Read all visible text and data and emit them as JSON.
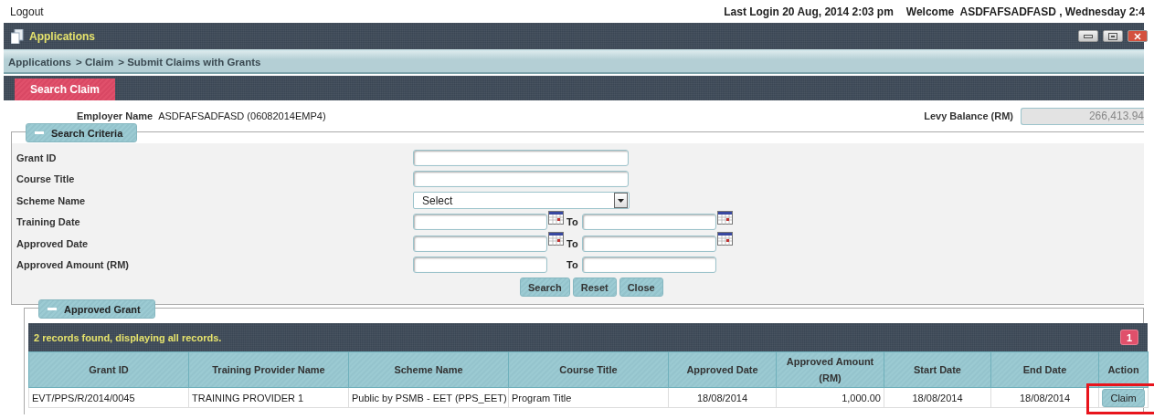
{
  "top_bar": {
    "logout": "Logout",
    "last_login": "Last Login 20 Aug, 2014 2:03 pm",
    "welcome": "Welcome  ASDFAFSADFASD , Wednesday 2:4"
  },
  "window": {
    "title": "Applications"
  },
  "breadcrumb": [
    "Applications",
    "> Claim",
    "> Submit Claims with Grants"
  ],
  "tabs": [
    {
      "label": "Search Claim",
      "selected": true
    }
  ],
  "employer": {
    "label": "Employer Name",
    "value": "ASDFAFSADFASD (06082014EMP4)"
  },
  "levy": {
    "label": "Levy Balance (RM)",
    "value": "266,413.94"
  },
  "search_criteria": {
    "title": "Search Criteria",
    "expanded": true,
    "fields": [
      {
        "kind": "text",
        "label": "Grant ID"
      },
      {
        "kind": "text",
        "label": "Course Title"
      },
      {
        "kind": "select",
        "label": "Scheme Name",
        "value": "Select"
      },
      {
        "kind": "date_range",
        "label": "Training Date",
        "to": "To"
      },
      {
        "kind": "date_range",
        "label": "Approved Date",
        "to": "To"
      },
      {
        "kind": "range",
        "label": "Approved Amount (RM)",
        "to": "To"
      }
    ],
    "buttons": [
      "Search",
      "Reset",
      "Close"
    ]
  },
  "approved_grant": {
    "title": "Approved Grant",
    "expanded": true,
    "summary": "2 records found, displaying all records.",
    "pages": [
      {
        "label": "1",
        "selected": true
      }
    ],
    "columns": [
      "Grant ID",
      "Training Provider Name",
      "Scheme Name",
      "Course Title",
      "Approved Date",
      "Approved Amount (RM)",
      "Start Date",
      "End Date",
      "Action"
    ],
    "rows": [
      {
        "cells": [
          "EVT/PPS/R/2014/0045",
          "TRAINING PROVIDER 1",
          "Public by PSMB - EET (PPS_EET)",
          "Program Title",
          "18/08/2014",
          "1,000.00",
          "18/08/2014",
          "18/08/2014"
        ],
        "action": "Claim",
        "highlighted": true
      }
    ]
  }
}
